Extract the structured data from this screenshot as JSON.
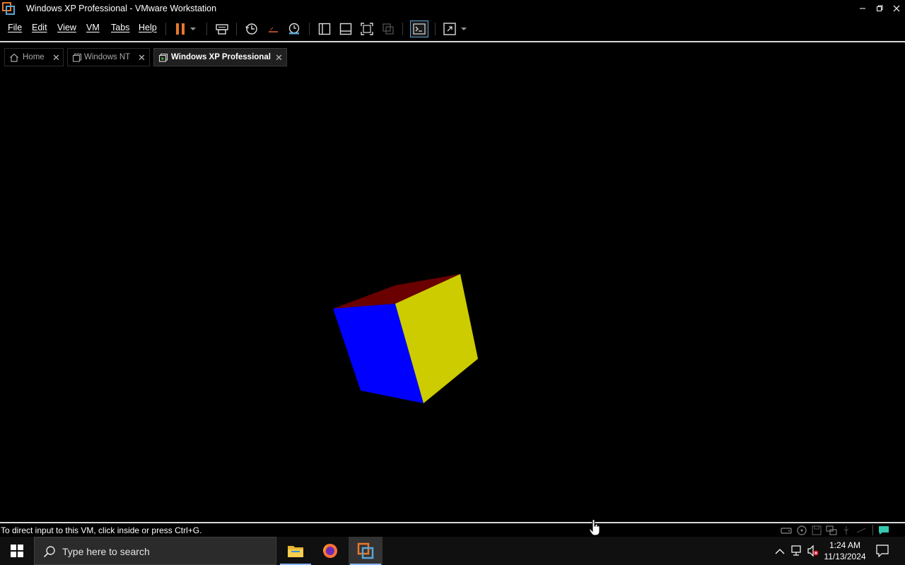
{
  "window": {
    "title": "Windows XP Professional - VMware Workstation",
    "icon": "vmware-icon",
    "controls": [
      "minimize-icon",
      "restore-icon",
      "close-icon"
    ]
  },
  "menu": {
    "items": [
      "File",
      "Edit",
      "View",
      "VM",
      "Tabs",
      "Help"
    ]
  },
  "toolbar": {
    "buttons": [
      "pause-icon",
      "dropdown-arrow-icon",
      "send-ctrl-alt-del-icon",
      "snapshot-icon",
      "revert-snapshot-icon",
      "snapshot-manager-icon",
      "show-library-icon",
      "show-thumbnail-icon",
      "full-screen-icon",
      "unity-icon",
      "console-view-icon",
      "stretch-guest-icon",
      "dropdown-arrow-icon"
    ],
    "pause_color": "#e8782a"
  },
  "tabs": [
    {
      "label": "Home",
      "icon": "home-icon",
      "active": false
    },
    {
      "label": "Windows NT",
      "icon": "vm-icon",
      "active": false
    },
    {
      "label": "Windows XP Professional",
      "icon": "vm-running-icon",
      "active": true
    }
  ],
  "vm_display": {
    "content": "rotating-cube",
    "cube_colors": {
      "left": "#0000ff",
      "right": "#cccc00",
      "top": "#6b0000"
    }
  },
  "statusbar": {
    "text": "To direct input to this VM, click inside or press Ctrl+G.",
    "icons": [
      "hard-disk-icon",
      "cd-drive-icon",
      "floppy-icon",
      "network-icon",
      "usb-icon",
      "sound-icon",
      "message-icon"
    ]
  },
  "taskbar": {
    "search_placeholder": "Type here to search",
    "apps": [
      {
        "name": "File Explorer",
        "icon": "file-explorer-icon"
      },
      {
        "name": "Firefox",
        "icon": "firefox-icon"
      },
      {
        "name": "VMware Workstation",
        "icon": "vmware-icon",
        "active": true
      }
    ],
    "tray_icons": [
      "chevron-up-icon",
      "network-icon",
      "volume-muted-icon"
    ],
    "time": "1:24 AM",
    "date": "11/13/2024",
    "notification_icon": "notification-icon"
  }
}
